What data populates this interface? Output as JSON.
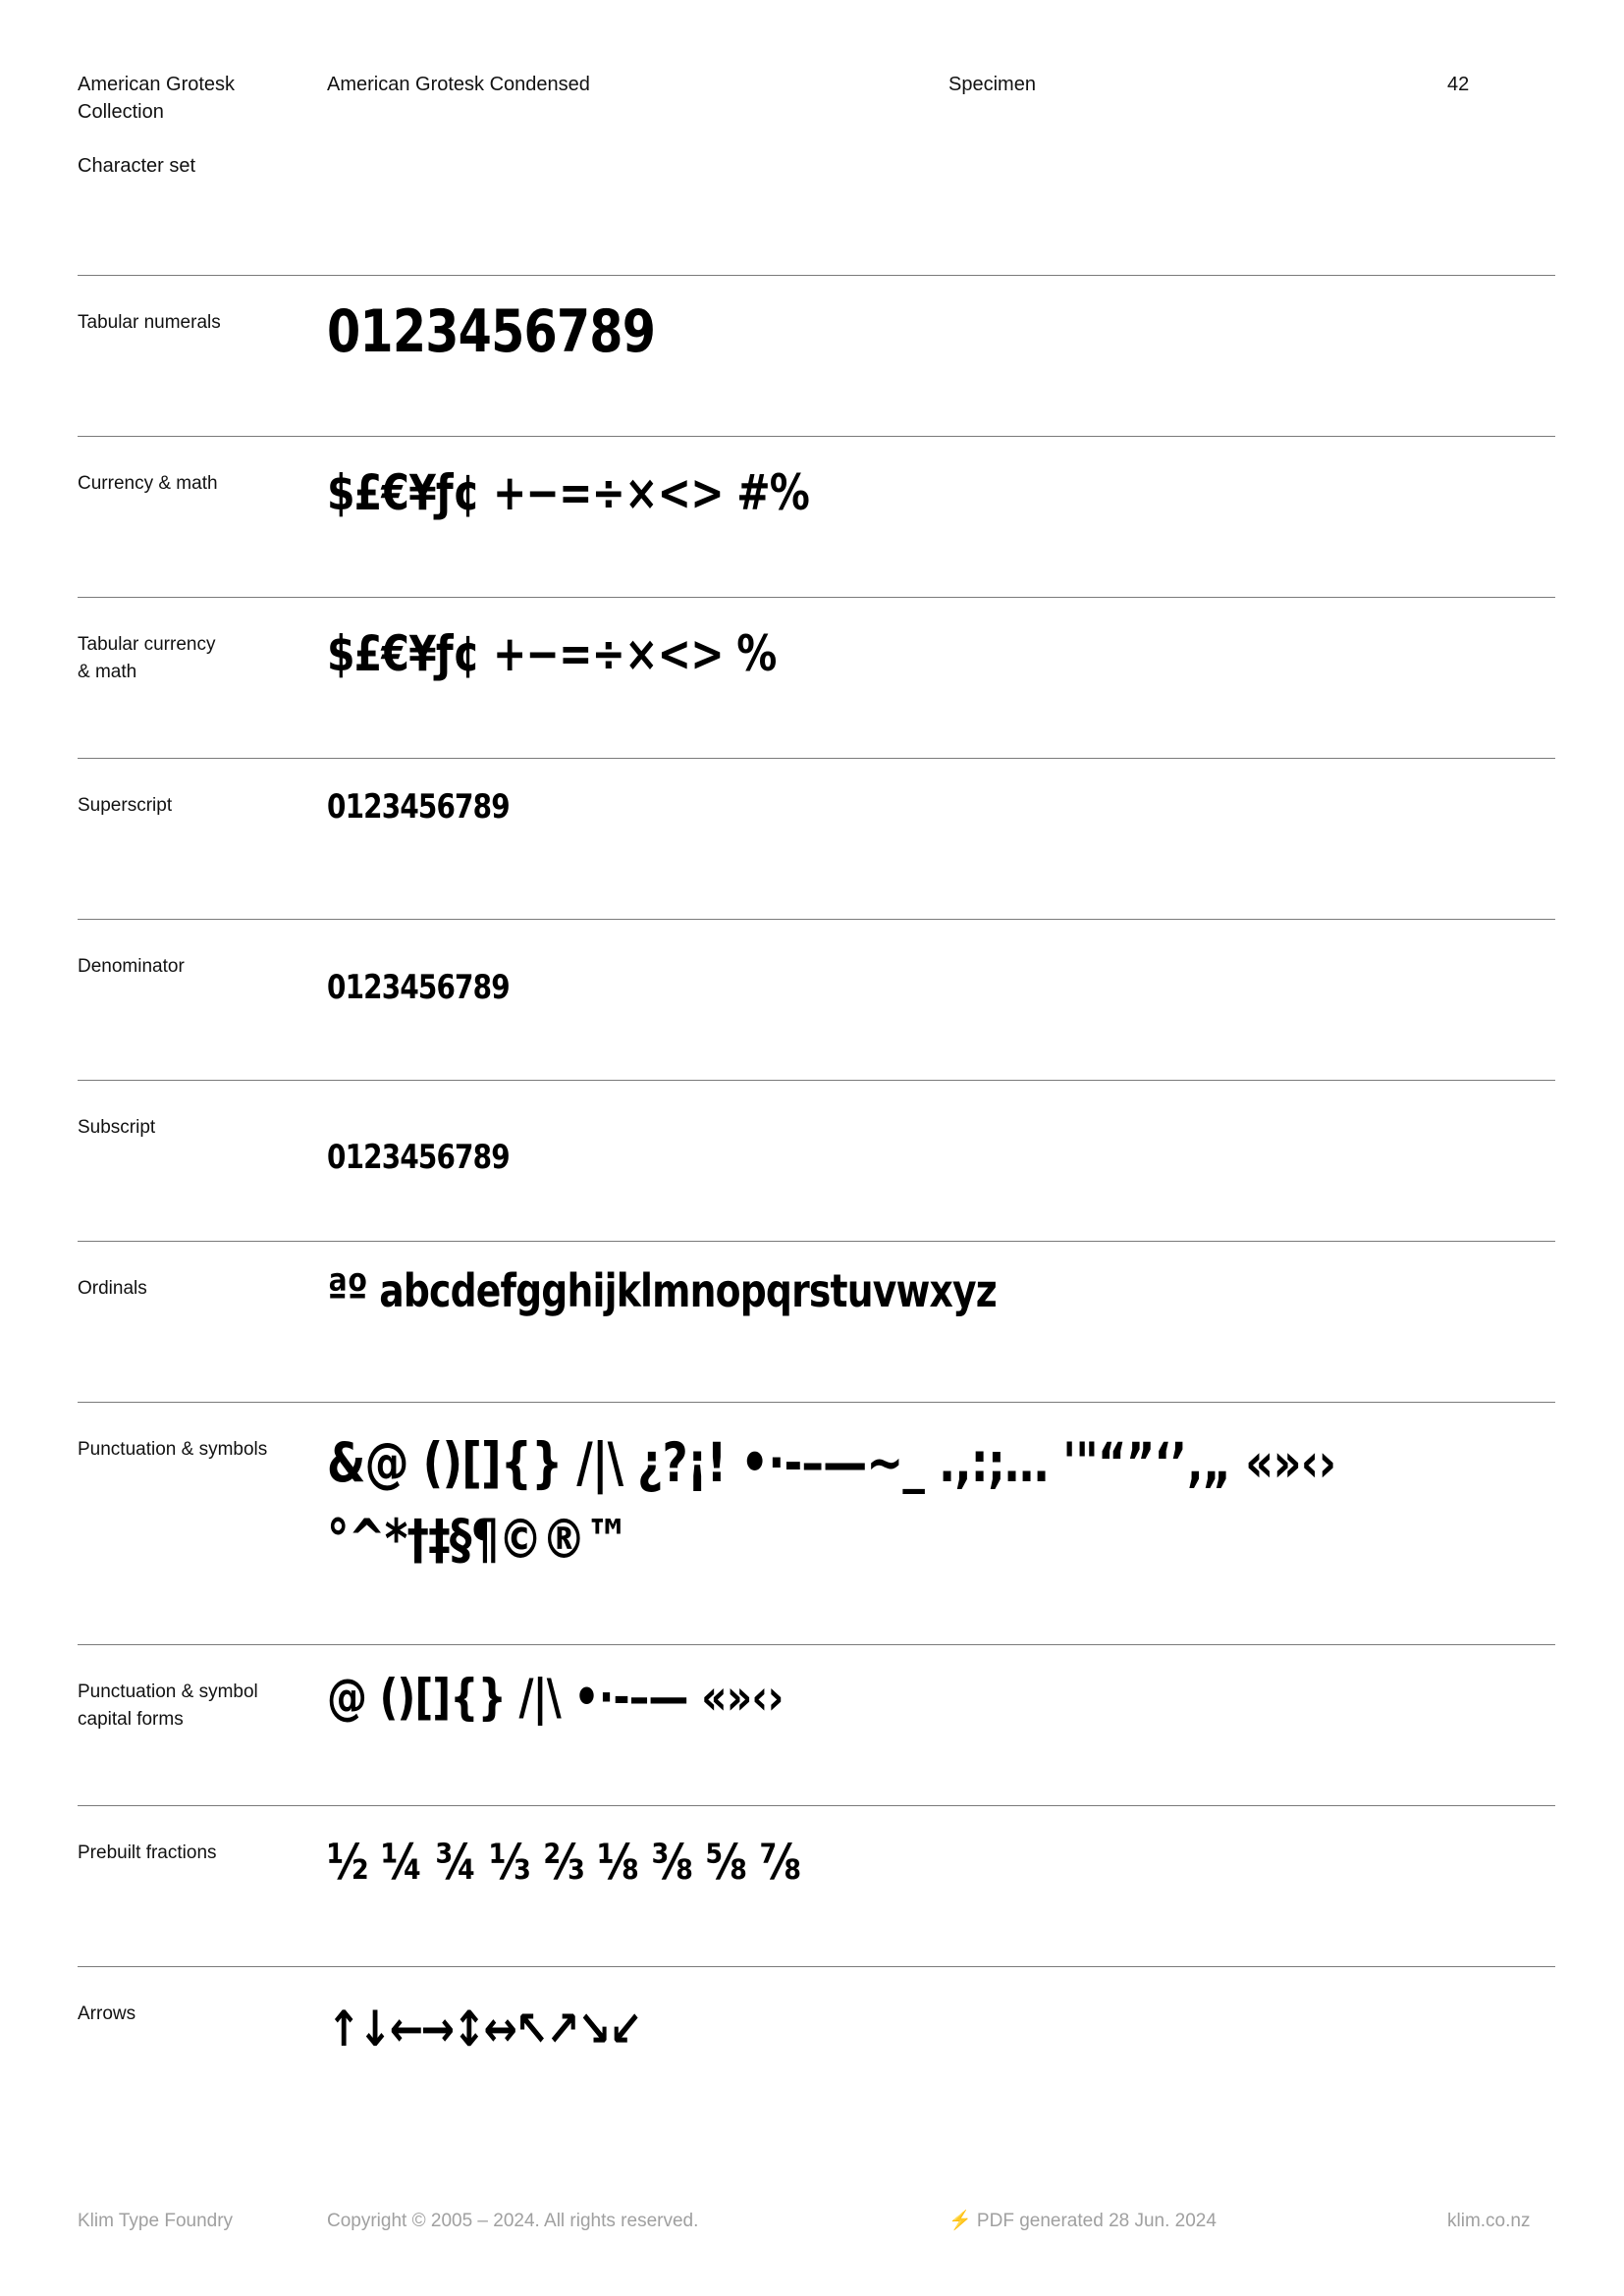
{
  "header": {
    "collection": "American Grotesk Collection",
    "family": "American Grotesk Condensed",
    "section": "Specimen",
    "page_number": "42",
    "subtitle": "Character set"
  },
  "rows": [
    {
      "label": "Tabular numerals",
      "sample": "0123456789"
    },
    {
      "label": "Currency & math",
      "sample": "$£€¥ƒ¢ +−=÷×<> #%"
    },
    {
      "label": "Tabular currency\n& math",
      "sample": "$£€¥ƒ¢ +−=÷×<> %"
    },
    {
      "label": "Superscript",
      "sample": "0123456789"
    },
    {
      "label": "Denominator",
      "sample": "0123456789"
    },
    {
      "label": "Subscript",
      "sample": "0123456789"
    },
    {
      "label": "Ordinals",
      "sample": "ªº abcdefgghijklmnopqrstuvwxyz"
    },
    {
      "label": "Punctuation & symbols",
      "sample": "&@ ()[]{} /|\\ ¿?¡! •·‐–—~_ .,:;… '\"“”‘’‚„ «»‹› °^*†‡§¶©®™"
    },
    {
      "label": "Punctuation & symbol\ncapital forms",
      "sample": "@ ()[]{} /|\\ •·‐–— «»‹›"
    },
    {
      "label": "Prebuilt fractions",
      "sample": "½ ¼ ¾ ⅓ ⅔ ⅛ ⅜ ⅝ ⅞"
    },
    {
      "label": "Arrows",
      "sample": "↑↓←→↕↔↖↗↘↙"
    }
  ],
  "footer": {
    "foundry": "Klim Type Foundry",
    "copyright": "Copyright © 2005 – 2024. All rights reserved.",
    "generated": "⚡ PDF generated 28 Jun. 2024",
    "site": "klim.co.nz"
  }
}
